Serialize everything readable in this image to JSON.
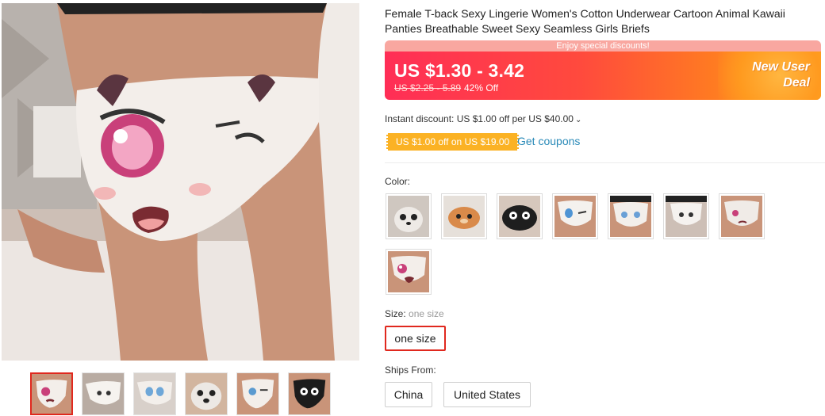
{
  "product": {
    "title": "Female T-back Sexy Lingerie Women's Cotton Underwear Cartoon Animal Kawaii Panties Breathable Sweet Sexy Seamless Girls Briefs"
  },
  "promo": {
    "banner": "Enjoy special discounts!",
    "price_range": "US $1.30 - 3.42",
    "original_price": "US $2.25 - 5.89",
    "discount": "42% Off",
    "deal_line1": "New User",
    "deal_line2": "Deal"
  },
  "discounts": {
    "instant": "Instant discount: US $1.00 off per US $40.00",
    "coupon": "US $1.00 off on US $19.00",
    "get_coupons": "Get coupons"
  },
  "color": {
    "label": "Color:"
  },
  "size": {
    "label": "Size:",
    "value": "one size",
    "option": "one size"
  },
  "ships": {
    "label": "Ships From:",
    "options": [
      "China",
      "United States"
    ]
  },
  "colors": {
    "accent": "#e0281e",
    "link": "#2a8ab8",
    "coupon": "#fbb224"
  }
}
